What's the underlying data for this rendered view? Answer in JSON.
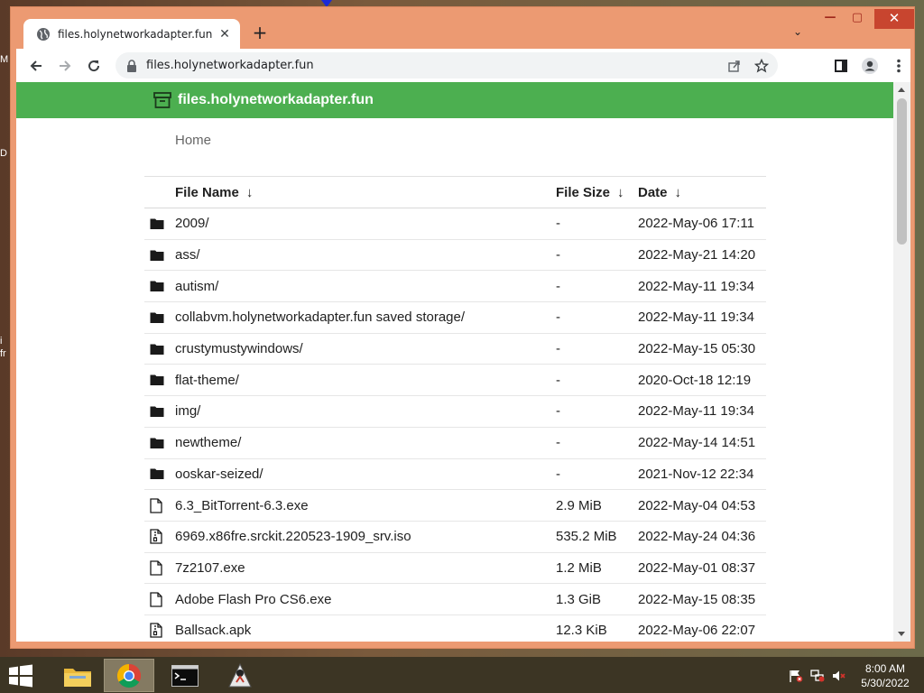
{
  "desktop": {
    "edge_labels": [
      "M",
      "D",
      "i",
      "fr"
    ]
  },
  "browser": {
    "tab_title": "files.holynetworkadapter.fun",
    "tab_close": "✕",
    "new_tab": "+",
    "tab_search": "⌄",
    "window_controls": {
      "minimize": "—",
      "maximize": "▢",
      "close": "✕"
    },
    "url": "files.holynetworkadapter.fun"
  },
  "page": {
    "site_title": "files.holynetworkadapter.fun",
    "breadcrumb": "Home",
    "columns": {
      "name": "File Name",
      "size": "File Size",
      "date": "Date",
      "sort_arrow": "↓"
    },
    "rows": [
      {
        "icon": "folder",
        "name": "2009/",
        "size": "-",
        "date": "2022-May-06 17:11"
      },
      {
        "icon": "folder",
        "name": "ass/",
        "size": "-",
        "date": "2022-May-21 14:20"
      },
      {
        "icon": "folder",
        "name": "autism/",
        "size": "-",
        "date": "2022-May-11 19:34"
      },
      {
        "icon": "folder",
        "name": "collabvm.holynetworkadapter.fun saved storage/",
        "size": "-",
        "date": "2022-May-11 19:34"
      },
      {
        "icon": "folder",
        "name": "crustymustywindows/",
        "size": "-",
        "date": "2022-May-15 05:30"
      },
      {
        "icon": "folder",
        "name": "flat-theme/",
        "size": "-",
        "date": "2020-Oct-18 12:19"
      },
      {
        "icon": "folder",
        "name": "img/",
        "size": "-",
        "date": "2022-May-11 19:34"
      },
      {
        "icon": "folder",
        "name": "newtheme/",
        "size": "-",
        "date": "2022-May-14 14:51"
      },
      {
        "icon": "folder",
        "name": "ooskar-seized/",
        "size": "-",
        "date": "2021-Nov-12 22:34"
      },
      {
        "icon": "file",
        "name": "6.3_BitTorrent-6.3.exe",
        "size": "2.9 MiB",
        "date": "2022-May-04 04:53"
      },
      {
        "icon": "archive-file",
        "name": "6969.x86fre.srckit.220523-1909_srv.iso",
        "size": "535.2 MiB",
        "date": "2022-May-24 04:36"
      },
      {
        "icon": "file",
        "name": "7z2107.exe",
        "size": "1.2 MiB",
        "date": "2022-May-01 08:37"
      },
      {
        "icon": "file",
        "name": "Adobe Flash Pro CS6.exe",
        "size": "1.3 GiB",
        "date": "2022-May-15 08:35"
      },
      {
        "icon": "archive-file",
        "name": "Ballsack.apk",
        "size": "12.3 KiB",
        "date": "2022-May-06 22:07"
      }
    ]
  },
  "taskbar": {
    "time": "8:00 AM",
    "date": "5/30/2022"
  },
  "colors": {
    "window_frame": "#ec9a72",
    "header_green": "#4caf50",
    "close_red": "#c8452f"
  }
}
